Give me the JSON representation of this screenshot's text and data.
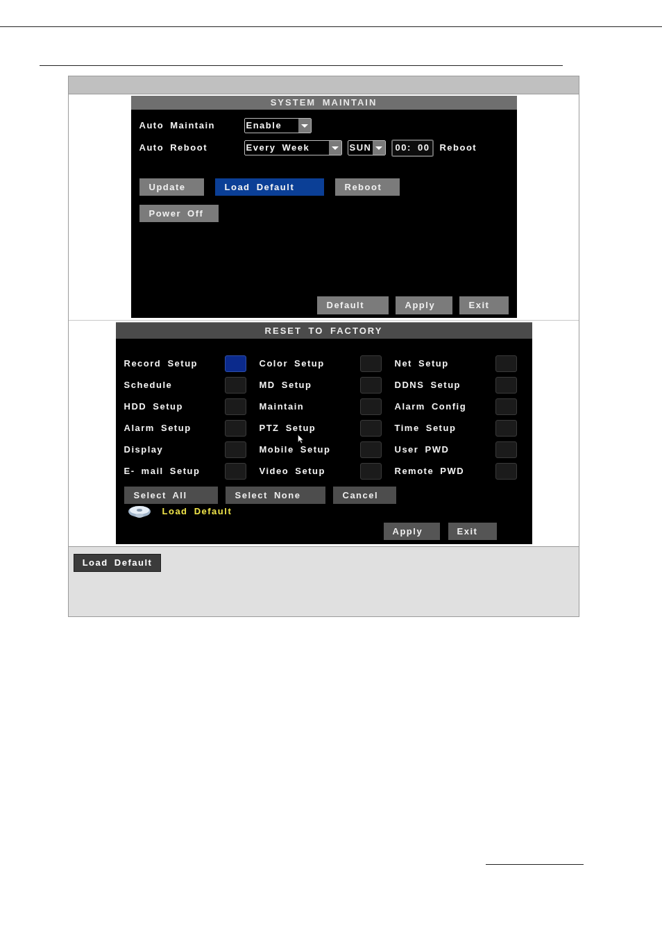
{
  "system_maintain": {
    "title": "SYSTEM MAINTAIN",
    "settings": [
      {
        "label": "Auto Maintain",
        "controls": [
          {
            "kind": "dropdown",
            "value": "Enable"
          }
        ]
      },
      {
        "label": "Auto Reboot",
        "controls": [
          {
            "kind": "dropdown",
            "value": "Every Week"
          },
          {
            "kind": "dropdown",
            "value": "SUN"
          },
          {
            "kind": "time",
            "value": "00: 00"
          },
          {
            "kind": "text",
            "value": "Reboot"
          }
        ]
      }
    ],
    "actions": [
      {
        "label": "Update",
        "selected": false
      },
      {
        "label": "Load Default",
        "selected": true
      },
      {
        "label": "Reboot",
        "selected": false
      },
      {
        "label": "Power Off",
        "selected": false
      }
    ],
    "footer_buttons": [
      "Default",
      "Apply",
      "Exit"
    ]
  },
  "reset_to_factory": {
    "title": "RESET TO FACTORY",
    "items": [
      {
        "label": "Record Setup",
        "selected": true
      },
      {
        "label": "Color Setup",
        "selected": false
      },
      {
        "label": "Net Setup",
        "selected": false
      },
      {
        "label": "Schedule",
        "selected": false
      },
      {
        "label": "MD Setup",
        "selected": false
      },
      {
        "label": "DDNS Setup",
        "selected": false
      },
      {
        "label": "HDD Setup",
        "selected": false
      },
      {
        "label": "Maintain",
        "selected": false
      },
      {
        "label": "Alarm Config",
        "selected": false
      },
      {
        "label": "Alarm Setup",
        "selected": false
      },
      {
        "label": "PTZ Setup",
        "selected": false
      },
      {
        "label": "Time Setup",
        "selected": false
      },
      {
        "label": "Display",
        "selected": false
      },
      {
        "label": "Mobile Setup",
        "selected": false
      },
      {
        "label": "User PWD",
        "selected": false
      },
      {
        "label": "E- mail Setup",
        "selected": false
      },
      {
        "label": "Video Setup",
        "selected": false
      },
      {
        "label": "Remote PWD",
        "selected": false
      }
    ],
    "buttons": [
      "Select All",
      "Select None",
      "Cancel"
    ],
    "status": "Load Default",
    "footer_buttons": [
      "Apply",
      "Exit"
    ]
  },
  "description": {
    "button": "Load Default"
  }
}
